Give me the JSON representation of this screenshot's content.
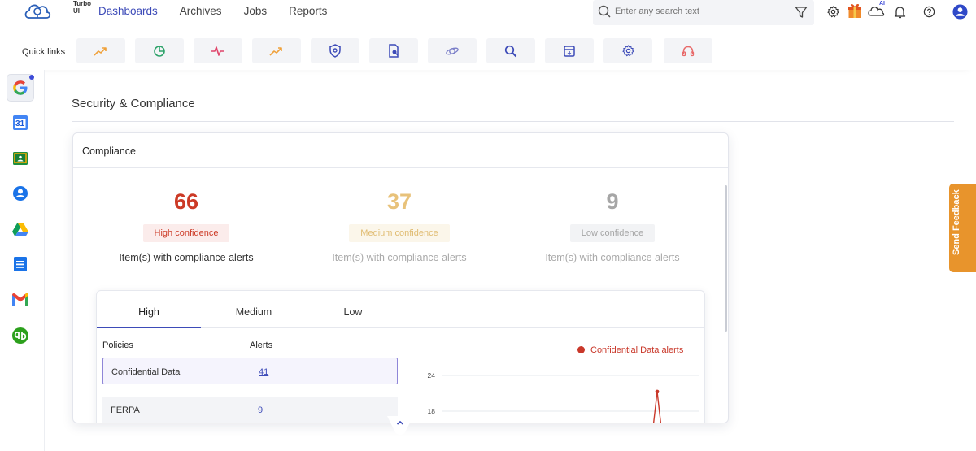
{
  "app": {
    "logo_text": "Turbo UI"
  },
  "nav": {
    "items": [
      "Dashboards",
      "Archives",
      "Jobs",
      "Reports"
    ],
    "active": "Dashboards"
  },
  "search": {
    "placeholder": "Enter any search text"
  },
  "topbar_icons": [
    "filter-icon",
    "gear-icon",
    "gift-icon",
    "ai-cloud-icon",
    "bell-icon",
    "help-icon",
    "user-icon"
  ],
  "ai_label": "AI",
  "quick_links": {
    "label": "Quick links",
    "icons": [
      "trend-up-icon",
      "pie-chart-icon",
      "pulse-icon",
      "trend-up-icon",
      "shield-icon",
      "report-icon",
      "satellite-icon",
      "search-icon",
      "archive-icon",
      "gear-icon",
      "headset-icon"
    ]
  },
  "apps": [
    "google",
    "calendar",
    "classroom",
    "contacts",
    "drive",
    "forms",
    "gmail",
    "quickbooks"
  ],
  "calendar_day": "31",
  "section": {
    "title": "Security & Compliance"
  },
  "compliance": {
    "title": "Compliance",
    "stats": [
      {
        "value": "66",
        "label": "High confidence",
        "desc": "Item(s) with compliance alerts",
        "color": "#cc3a26",
        "badge_bg": "#fbeceb",
        "badge_color": "#cc3a26",
        "desc_color": "#333333"
      },
      {
        "value": "37",
        "label": "Medium confidence",
        "desc": "Item(s) with compliance alerts",
        "color": "#e8c27a",
        "badge_bg": "#fbf6ea",
        "badge_color": "#e0bc72",
        "desc_color": "#aaaaaa"
      },
      {
        "value": "9",
        "label": "Low confidence",
        "desc": "Item(s) with compliance alerts",
        "color": "#a6a6a6",
        "badge_bg": "#f2f3f5",
        "badge_color": "#a6a6a6",
        "desc_color": "#aaaaaa"
      }
    ],
    "tabs": [
      "High",
      "Medium",
      "Low"
    ],
    "active_tab": "High",
    "table": {
      "headers": [
        "Policies",
        "Alerts"
      ],
      "rows": [
        {
          "policy": "Confidential Data",
          "alerts": "41"
        },
        {
          "policy": "FERPA",
          "alerts": "9"
        }
      ]
    }
  },
  "chart_data": {
    "type": "line",
    "series": [
      {
        "name": "Confidential Data alerts",
        "color": "#c9382a"
      }
    ],
    "y_ticks": [
      "24",
      "18"
    ],
    "grid": true,
    "legend": "top-right"
  },
  "feedback": {
    "label": "Send Feedback"
  }
}
